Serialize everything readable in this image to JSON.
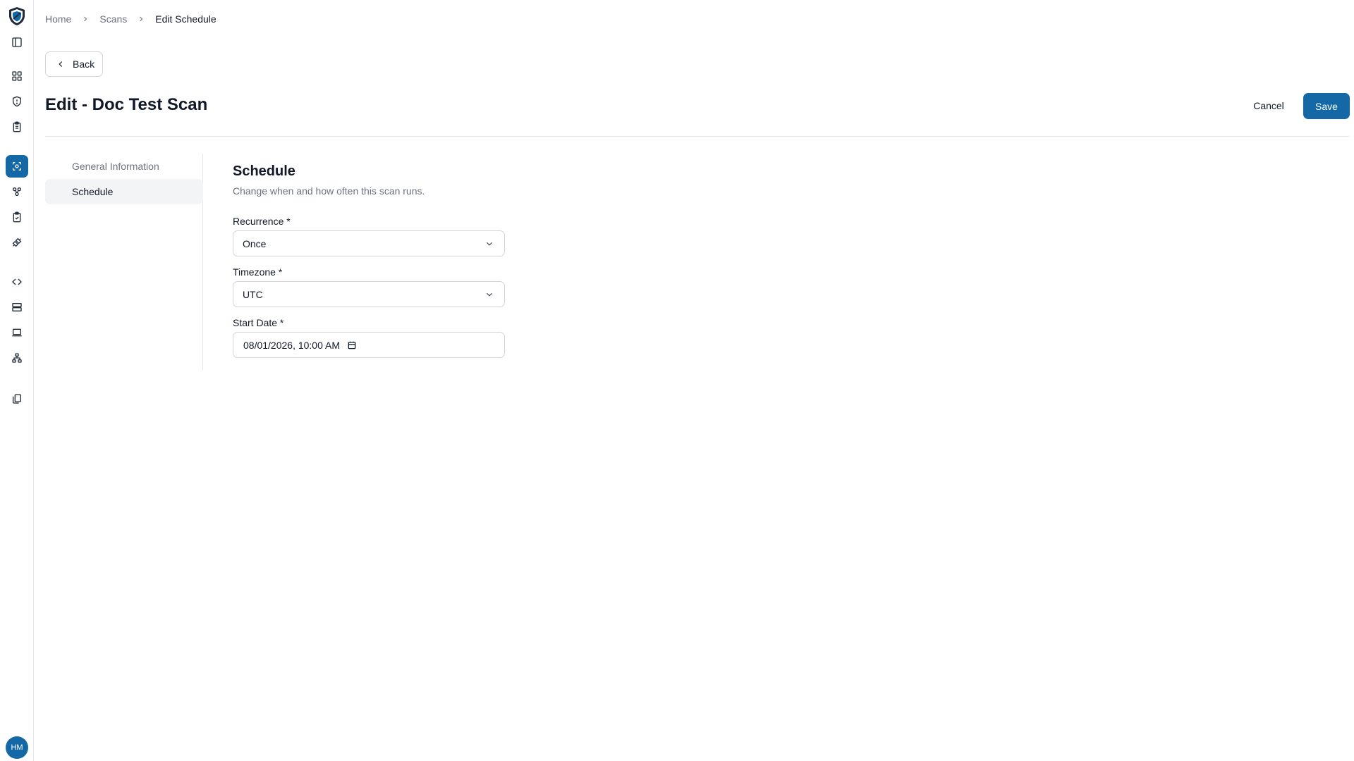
{
  "rail": {
    "logo": "shield-logo",
    "items": [
      {
        "icon": "sidebar-toggle-icon"
      },
      {
        "icon": "dashboard-icon"
      },
      {
        "icon": "shield-alert-icon"
      },
      {
        "icon": "clipboard-list-icon"
      },
      {
        "icon": "scan-icon",
        "active": true
      },
      {
        "icon": "hierarchy-icon"
      },
      {
        "icon": "clipboard-check-icon"
      },
      {
        "icon": "integrations-icon"
      },
      {
        "icon": "code-icon"
      },
      {
        "icon": "server-icon"
      },
      {
        "icon": "laptop-icon"
      },
      {
        "icon": "network-icon"
      },
      {
        "icon": "documents-icon"
      }
    ],
    "avatar_initials": "HM"
  },
  "breadcrumb": [
    "Home",
    "Scans",
    "Edit Schedule"
  ],
  "back_label": "Back",
  "page_title": "Edit - Doc Test Scan",
  "actions": {
    "cancel": "Cancel",
    "save": "Save"
  },
  "side_nav": [
    {
      "label": "General Information",
      "active": false
    },
    {
      "label": "Schedule",
      "active": true
    }
  ],
  "section": {
    "title": "Schedule",
    "description": "Change when and how often this scan runs."
  },
  "fields": {
    "recurrence": {
      "label": "Recurrence *",
      "value": "Once"
    },
    "timezone": {
      "label": "Timezone *",
      "value": "UTC"
    },
    "start_date": {
      "label": "Start Date *",
      "value": "08/01/2026, 10:00 AM"
    }
  },
  "colors": {
    "accent": "#1568a6",
    "border": "#e5e7eb",
    "muted_text": "#6b7280"
  }
}
